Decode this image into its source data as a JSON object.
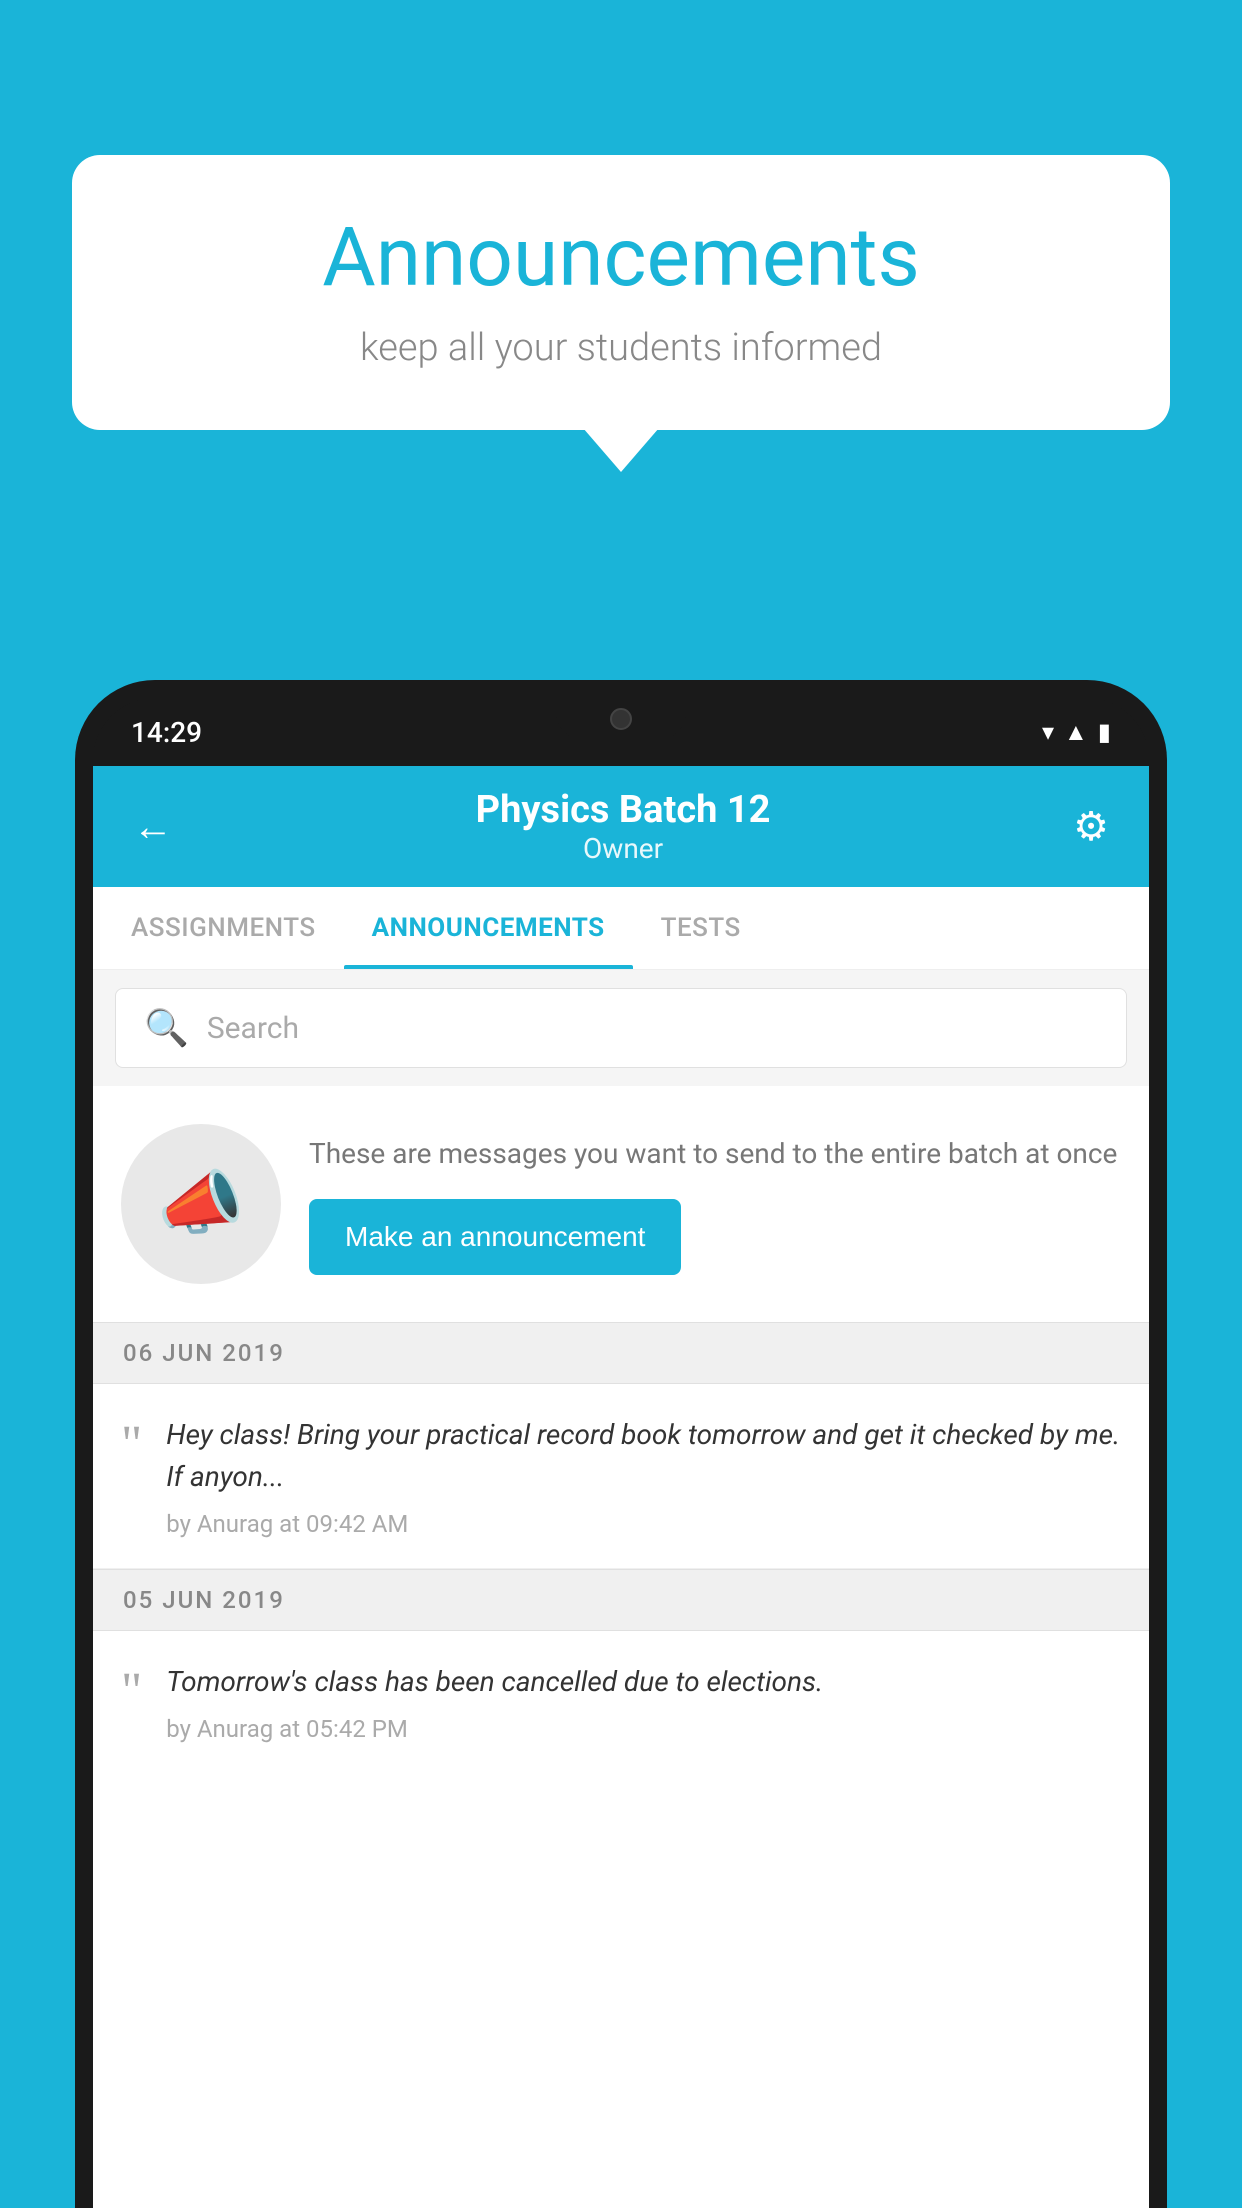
{
  "background_color": "#1ab4d8",
  "speech_bubble": {
    "title": "Announcements",
    "subtitle": "keep all your students informed"
  },
  "phone": {
    "status_bar": {
      "time": "14:29",
      "icons": [
        "wifi",
        "signal",
        "battery"
      ]
    },
    "header": {
      "title": "Physics Batch 12",
      "subtitle": "Owner",
      "back_label": "←",
      "gear_label": "⚙"
    },
    "tabs": [
      {
        "label": "ASSIGNMENTS",
        "active": false
      },
      {
        "label": "ANNOUNCEMENTS",
        "active": true
      },
      {
        "label": "TESTS",
        "active": false
      }
    ],
    "search": {
      "placeholder": "Search"
    },
    "promo": {
      "description": "These are messages you want to send to the entire batch at once",
      "button_label": "Make an announcement"
    },
    "announcements": [
      {
        "date": "06  JUN  2019",
        "text": "Hey class! Bring your practical record book tomorrow and get it checked by me. If anyon...",
        "meta": "by Anurag at 09:42 AM"
      },
      {
        "date": "05  JUN  2019",
        "text": "Tomorrow's class has been cancelled due to elections.",
        "meta": "by Anurag at 05:42 PM"
      }
    ]
  }
}
